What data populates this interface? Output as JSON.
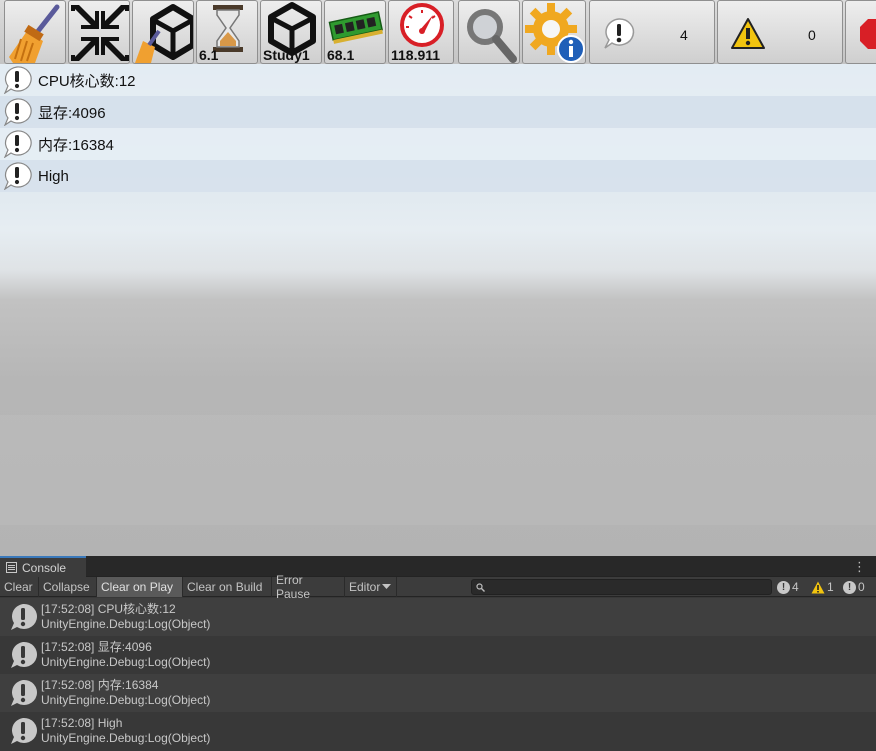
{
  "toolbar": {
    "buttons": [
      {
        "name": "broom-icon"
      },
      {
        "name": "collapse-icon"
      },
      {
        "name": "unity-clean-icon"
      },
      {
        "name": "hourglass-icon",
        "label": "6.1"
      },
      {
        "name": "unity-logo-icon",
        "label": "Study1"
      },
      {
        "name": "memory-icon",
        "label": "68.1"
      },
      {
        "name": "speedometer-icon",
        "label": "118.911"
      },
      {
        "name": "magnifier-icon"
      },
      {
        "name": "settings-info-icon"
      }
    ],
    "log_count": "4",
    "warning_count": "0"
  },
  "game_logs": [
    {
      "text": "CPU核心数:12"
    },
    {
      "text": "显存:4096"
    },
    {
      "text": "内存:16384"
    },
    {
      "text": "High"
    }
  ],
  "console": {
    "tab_label": "Console",
    "menu_glyph": "⋮",
    "toolbar": {
      "clear": "Clear",
      "collapse": "Collapse",
      "clear_on_play": "Clear on Play",
      "clear_on_build": "Clear on Build",
      "error_pause": "Error Pause",
      "editor": "Editor",
      "search_placeholder": ""
    },
    "counts": {
      "log": "4",
      "warning": "1",
      "error": "0"
    },
    "entries": [
      {
        "line1": "[17:52:08] CPU核心数:12",
        "line2": "UnityEngine.Debug:Log(Object)"
      },
      {
        "line1": "[17:52:08] 显存:4096",
        "line2": "UnityEngine.Debug:Log(Object)"
      },
      {
        "line1": "[17:52:08] 内存:16384",
        "line2": "UnityEngine.Debug:Log(Object)"
      },
      {
        "line1": "[17:52:08] High",
        "line2": "UnityEngine.Debug:Log(Object)"
      }
    ]
  },
  "colors": {
    "console_bg": "#383838",
    "tab_accent": "#3a79bb",
    "warning_yellow": "#f2c40f",
    "error_red": "#d81f26"
  }
}
